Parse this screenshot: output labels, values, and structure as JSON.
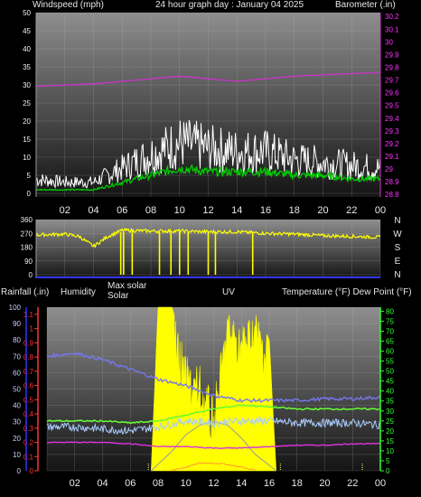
{
  "header": {
    "left": "Windspeed (mph)",
    "center": "24 hour graph day : January 04 2025",
    "right": "Barometer (.in)"
  },
  "legend": {
    "rain": "Rainfall (.in)",
    "humidity": "Humidity",
    "maxsolar": "Max solar",
    "solar": "Solar",
    "uv": "UV",
    "temp": "Temperature (°F) Dew Point (°F)"
  },
  "compass": [
    "N",
    "W",
    "S",
    "E",
    "N"
  ],
  "colors": {
    "background": "#000000",
    "plot_top": "#8a8a8a",
    "plot_bottom": "#141414",
    "wind_avg": "#00cc00",
    "wind_gust": "#ffffff",
    "barometer": "#cc33cc",
    "direction": "#ffff00",
    "rain": "#3333ff",
    "rain_axis": "#ff3333",
    "solar": "#ffff00",
    "humidity": "#7777ee",
    "temperature": "#66ff33",
    "dewpoint": "#aaccff",
    "magenta": "#dd33dd"
  },
  "chart_data": [
    {
      "type": "line",
      "panel": "wind-barometer",
      "title": "24 hour graph day : January 04 2025",
      "ylabel": "Windspeed (mph)",
      "y2label": "Barometer (.in)",
      "x_ticks": [
        "02",
        "04",
        "06",
        "08",
        "10",
        "12",
        "14",
        "16",
        "18",
        "20",
        "22",
        "00"
      ],
      "ylim": [
        0,
        50
      ],
      "y_ticks": [
        0,
        5,
        10,
        15,
        20,
        25,
        30,
        35,
        40,
        45,
        50
      ],
      "y2lim": [
        28.78,
        30.23
      ],
      "y2_ticks": [
        "28.8",
        "28.9",
        "29",
        "29.1",
        "29.2",
        "29.3",
        "29.4",
        "29.5",
        "29.6",
        "29.7",
        "29.8",
        "29.9",
        "30",
        "30.1",
        "30.2"
      ],
      "series": [
        {
          "name": "Barometer",
          "axis": "right",
          "x": [
            0,
            2,
            4,
            6,
            8,
            10,
            12,
            14,
            16,
            18,
            20,
            22,
            24
          ],
          "values": [
            29.65,
            29.66,
            29.67,
            29.69,
            29.71,
            29.73,
            29.71,
            29.69,
            29.71,
            29.73,
            29.74,
            29.75,
            29.76
          ]
        },
        {
          "name": "Wind speed",
          "x": [
            0,
            2,
            4,
            6,
            8,
            10,
            12,
            14,
            16,
            18,
            20,
            22,
            24
          ],
          "values": [
            1,
            1,
            1,
            3,
            5,
            7,
            6,
            6,
            6,
            5,
            5,
            4,
            4
          ]
        },
        {
          "name": "Wind gust",
          "x": [
            0,
            2,
            4,
            6,
            8,
            10,
            12,
            14,
            16,
            18,
            20,
            22,
            24
          ],
          "values": [
            5,
            4,
            4,
            9,
            14,
            18,
            16,
            15,
            15,
            12,
            11,
            10,
            9
          ]
        }
      ]
    },
    {
      "type": "line",
      "panel": "wind-direction",
      "x_ticks": [
        "02",
        "04",
        "06",
        "08",
        "10",
        "12",
        "14",
        "16",
        "18",
        "20",
        "22",
        "00"
      ],
      "ylim": [
        0,
        360
      ],
      "y_ticks": [
        0,
        90,
        180,
        270,
        360
      ],
      "series": [
        {
          "name": "Direction",
          "x": [
            0,
            2,
            3,
            4,
            5,
            6,
            8,
            10,
            12,
            14,
            16,
            18,
            20,
            22,
            24
          ],
          "values": [
            260,
            265,
            250,
            185,
            250,
            290,
            285,
            285,
            280,
            280,
            270,
            265,
            255,
            250,
            245
          ]
        }
      ]
    },
    {
      "type": "line",
      "panel": "rain-humidity-solar-temperature",
      "x_ticks": [
        "02",
        "04",
        "06",
        "08",
        "10",
        "12",
        "14",
        "16",
        "18",
        "20",
        "22",
        "00"
      ],
      "y_ticks_humidity": [
        0,
        10,
        20,
        30,
        40,
        50,
        60,
        70,
        80,
        90,
        100
      ],
      "y_ticks_rain": [
        "0",
        "0.1",
        "0.2",
        "0.3",
        "0.4",
        "0.5",
        "0.6",
        "0.7",
        "0.8",
        "0.9",
        "1",
        "1.1"
      ],
      "y_ticks_temp": [
        0,
        5,
        10,
        15,
        20,
        25,
        30,
        35,
        40,
        45,
        50,
        55,
        60,
        65,
        70,
        75,
        80
      ],
      "series": [
        {
          "name": "Humidity",
          "x": [
            0,
            2,
            4,
            6,
            8,
            10,
            12,
            14,
            16,
            18,
            20,
            22,
            24
          ],
          "values": [
            70,
            72,
            68,
            62,
            56,
            52,
            46,
            43,
            43,
            43,
            44,
            44,
            45
          ]
        },
        {
          "name": "Temperature",
          "x": [
            0,
            2,
            4,
            6,
            8,
            10,
            12,
            14,
            16,
            18,
            20,
            22,
            24
          ],
          "values": [
            25,
            25,
            25,
            24,
            25,
            28,
            31,
            33,
            32,
            31,
            31,
            31,
            31
          ]
        },
        {
          "name": "Dew Point",
          "x": [
            0,
            2,
            4,
            6,
            8,
            10,
            12,
            14,
            16,
            18,
            20,
            22,
            24
          ],
          "values": [
            22,
            22,
            21,
            20,
            22,
            25,
            24,
            25,
            25,
            24,
            24,
            24,
            23
          ]
        },
        {
          "name": "Rain",
          "x": [
            0,
            2,
            4,
            6,
            8,
            10,
            12,
            14,
            16,
            18,
            20,
            22,
            24
          ],
          "values": [
            0.2,
            0.2,
            0.2,
            0.19,
            0.17,
            0.17,
            0.16,
            0.16,
            0.17,
            0.18,
            0.18,
            0.19,
            0.19
          ]
        },
        {
          "name": "Solar",
          "x": [
            7.5,
            8,
            9,
            10,
            11,
            12,
            13,
            14,
            15,
            16,
            16.5
          ],
          "values": [
            0,
            100,
            100,
            70,
            65,
            45,
            100,
            90,
            100,
            80,
            0
          ]
        },
        {
          "name": "Max solar",
          "x": [
            7.5,
            9,
            10,
            11,
            12,
            13,
            14,
            15,
            16.5
          ],
          "values": [
            0,
            12,
            22,
            28,
            30,
            28,
            20,
            10,
            0
          ]
        },
        {
          "name": "UV",
          "x": [
            9,
            10,
            11,
            12,
            13,
            14,
            15
          ],
          "values": [
            0,
            0.02,
            0.05,
            0.05,
            0.04,
            0.02,
            0
          ]
        }
      ]
    }
  ]
}
